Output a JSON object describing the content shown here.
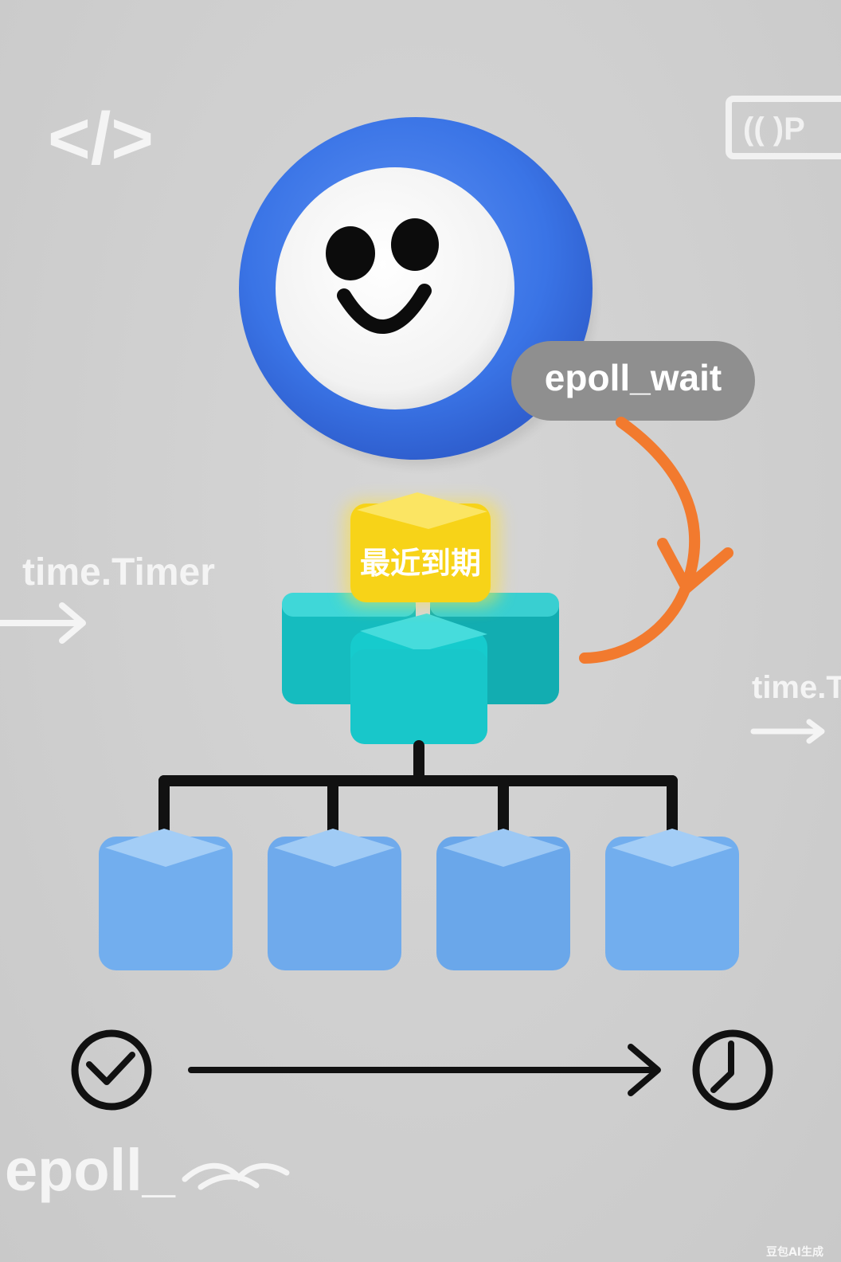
{
  "code_symbol": "</>",
  "corner_badge": "(( )P",
  "callout": {
    "text": "epoll_wait"
  },
  "highlight_block": {
    "text": "最近到期"
  },
  "side_labels": {
    "left": "time.Timer",
    "right": "time.T"
  },
  "bottom_label": "epoll_",
  "watermark": "豆包AI生成",
  "colors": {
    "background": "#d2d2d2",
    "ring_blue": "#3a74e6",
    "face_white": "#f7f7f7",
    "callout_gray": "#8e8e8e",
    "arrow_orange": "#f27a2e",
    "highlight_yellow": "#f7d318",
    "teal": "#16c9cc",
    "leaf_blue": "#7ab4ef",
    "line_black": "#111111"
  },
  "icons": [
    "code-icon",
    "smiley-face-icon",
    "clock-icon",
    "arrow-right-icon"
  ]
}
